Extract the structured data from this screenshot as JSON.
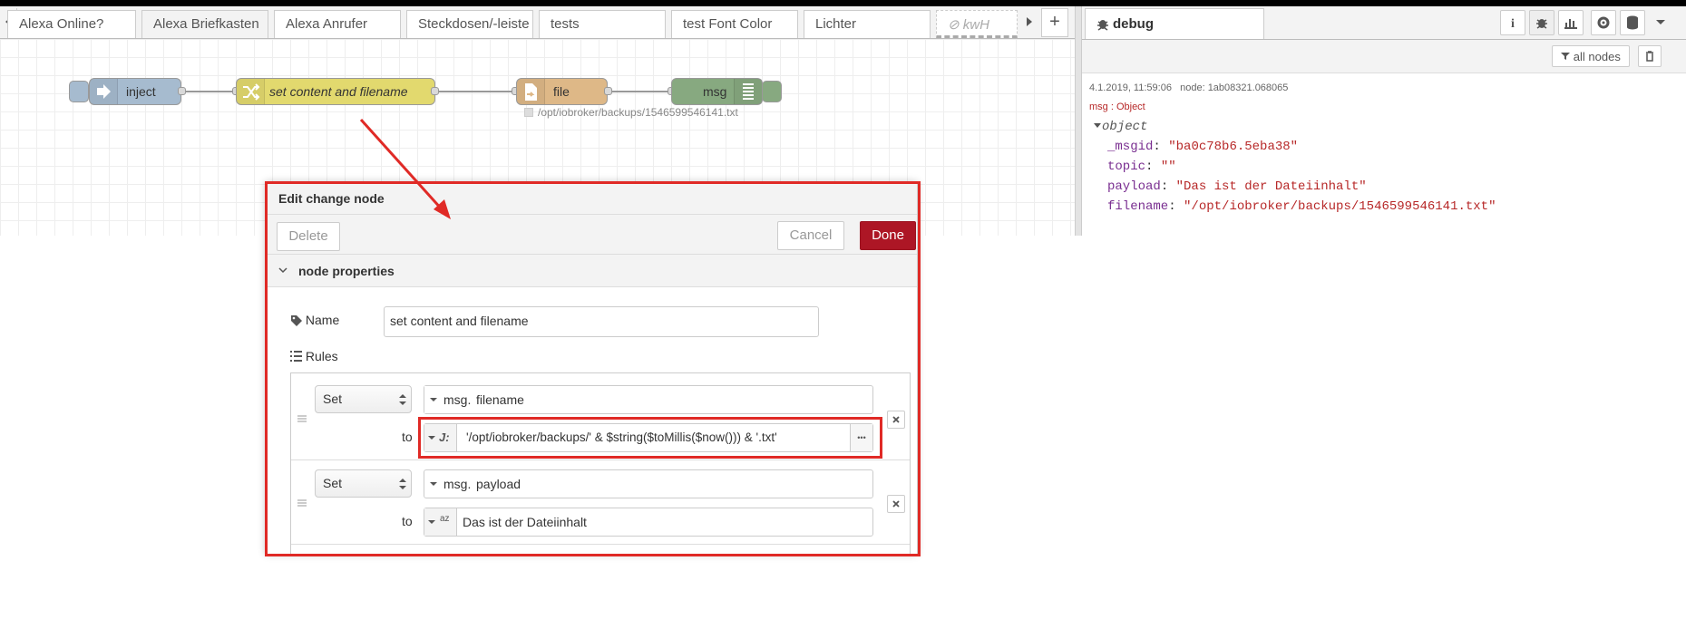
{
  "workspace_tabs": [
    {
      "label": "Alexa Online?",
      "state": "normal"
    },
    {
      "label": "Alexa Briefkasten",
      "state": "active"
    },
    {
      "label": "Alexa Anrufer",
      "state": "normal"
    },
    {
      "label": "Steckdosen/-leiste",
      "state": "normal"
    },
    {
      "label": "tests",
      "state": "normal"
    },
    {
      "label": "test Font Color",
      "state": "normal"
    },
    {
      "label": "Lichter",
      "state": "normal"
    },
    {
      "label": "kwH",
      "state": "disabled"
    }
  ],
  "tab_controls": {
    "add_label": "+"
  },
  "flow": {
    "nodes": [
      {
        "label": "inject",
        "color": "#a6bbcf"
      },
      {
        "label": "set content and filename",
        "color": "#e2d96e"
      },
      {
        "label": "file",
        "color": "#deb887"
      },
      {
        "label": "msg",
        "color": "#87a980"
      }
    ],
    "file_status": "/opt/iobroker/backups/1546599546141.txt"
  },
  "debug": {
    "tab_label": "debug",
    "filter_label": "all nodes",
    "message": {
      "timestamp": "4.1.2019, 11:59:06",
      "node": "node: 1ab08321.068065",
      "type": "msg : Object",
      "root": "object",
      "props": [
        {
          "key": "_msgid",
          "value": "\"ba0c78b6.5eba38\""
        },
        {
          "key": "topic",
          "value": "\"\""
        },
        {
          "key": "payload",
          "value": "\"Das ist der Dateiinhalt\""
        },
        {
          "key": "filename",
          "value": "\"/opt/iobroker/backups/1546599546141.txt\""
        }
      ]
    }
  },
  "dialog": {
    "title": "Edit change node",
    "delete_label": "Delete",
    "cancel_label": "Cancel",
    "done_label": "Done",
    "section_title": "node properties",
    "name_label": "Name",
    "name_value": "set content and filename",
    "rules_label": "Rules",
    "rules": [
      {
        "action": "Set",
        "target_prefix": "msg.",
        "target": "filename",
        "to_label": "to",
        "value_type": "J:",
        "value": "'/opt/iobroker/backups/' & $string($toMillis($now())) & '.txt'",
        "expand_label": "•••"
      },
      {
        "action": "Set",
        "target_prefix": "msg.",
        "target": "payload",
        "to_label": "to",
        "value_type": "az",
        "value": "Das ist der Dateiinhalt"
      }
    ]
  },
  "colors": {
    "primary": "#ad1625",
    "annotation": "#e02a26",
    "key": "#792e90",
    "string": "#b72828"
  }
}
